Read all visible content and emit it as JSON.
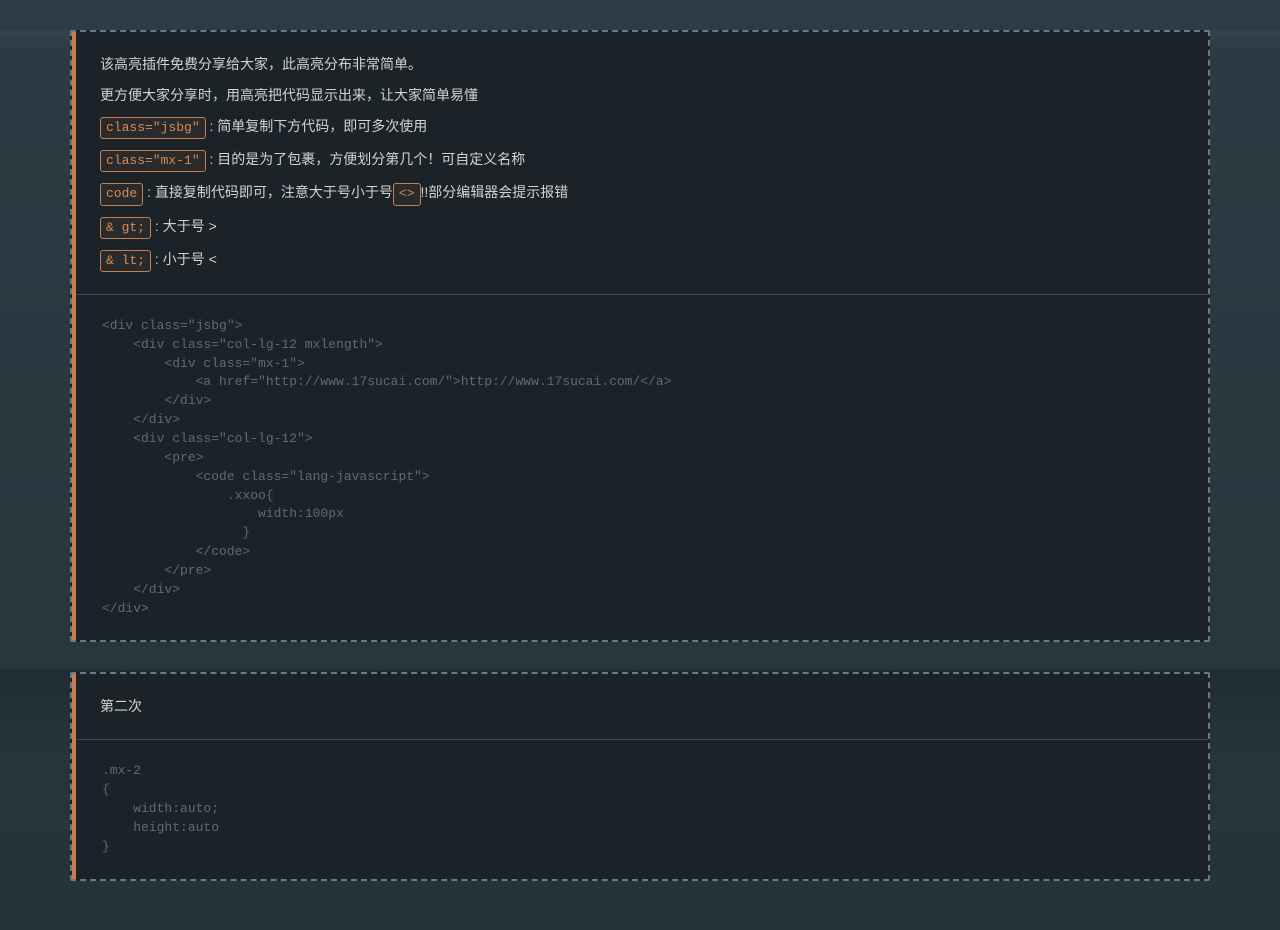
{
  "panel1": {
    "intro1": "该高亮插件免费分享给大家，此高亮分布非常简单。",
    "intro2": "更方便大家分享时，用高亮把代码显示出来，让大家简单易懂",
    "tag_jsbg": "class=\"jsbg\"",
    "desc_jsbg": " : 简单复制下方代码，即可多次使用",
    "tag_mx1": "class=\"mx-1\"",
    "desc_mx1": " : 目的是为了包裹，方便划分第几个！可自定义名称",
    "tag_code": "code",
    "desc_code_a": " : 直接复制代码即可，注意大于号小于号",
    "tag_arrows": "<>",
    "desc_code_b": "!!部分编辑器会提示报错",
    "tag_gt": "& gt;",
    "desc_gt": " : 大于号 >",
    "tag_lt": "& lt;",
    "desc_lt": " : 小于号 <",
    "code": "<div class=\"jsbg\">\n    <div class=\"col-lg-12 mxlength\">\n        <div class=\"mx-1\">\n            <a href=\"http://www.17sucai.com/\">http://www.17sucai.com/</a>\n        </div>\n    </div>\n    <div class=\"col-lg-12\">\n        <pre>\n            <code class=\"lang-javascript\">\n                .xxoo{\n                    width:100px\n                  }\n            </code>\n        </pre>\n    </div>\n</div>"
  },
  "panel2": {
    "title": "第二次",
    "code": ".mx-2\n{\n    width:auto;\n    height:auto\n}"
  }
}
